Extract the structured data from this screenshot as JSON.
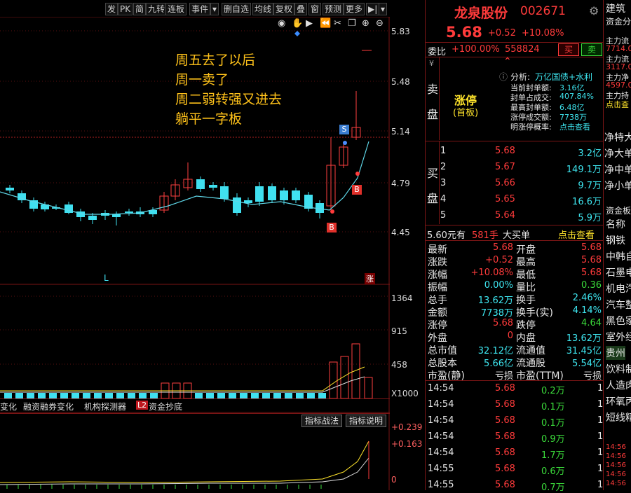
{
  "toolbar": {
    "items": [
      "发",
      "PK",
      "简",
      "九转",
      "连板",
      "事件",
      "▾",
      "删自选",
      "均线",
      "复权",
      "叠",
      "窗",
      "预测",
      "更多",
      "▶|",
      "▾"
    ]
  },
  "chart": {
    "y_labels": [
      "5.83",
      "5.48",
      "5.14",
      "4.79",
      "4.45"
    ],
    "vol_labels": [
      "1364",
      "915",
      "458",
      "X1000"
    ],
    "ind_labels": [
      "+0.239",
      "+0.163",
      "0"
    ],
    "marker_l": "L",
    "marker_zhang": "涨",
    "badge_s": "S",
    "badge_b": "B",
    "annotation": [
      "周五去了以后",
      "周一卖了",
      "周二弱转强又进去",
      "躺平一字板"
    ],
    "tabs": [
      "变化",
      "融资融券变化",
      "机构探测器",
      "L2",
      "资金抄底"
    ],
    "ind_buttons": [
      "指标战法",
      "指标说明"
    ],
    "icons": [
      "eye-icon",
      "hand-icon",
      "play-icon",
      "scissors-icon",
      "copy-icon",
      "zoom-in-icon",
      "zoom-out-icon"
    ]
  },
  "stock": {
    "name": "龙泉股份",
    "code": "002671",
    "price": "5.68",
    "change": "+0.52",
    "change_pct": "+10.08%",
    "weibi_label": "委比",
    "weibi": "+100.00%",
    "weicha": "558824",
    "buy_btn": "买",
    "sell_btn": "卖"
  },
  "sell_side": {
    "label1": "卖",
    "label2": "盘",
    "limit_up": "涨停",
    "limit_sub": "(首板)",
    "analysis_label": "分析:",
    "analysis_value": "万亿国债+水利",
    "rows": [
      {
        "k": "当前封单额:",
        "v": "3.16亿"
      },
      {
        "k": "封单占成交:",
        "v": "407.84%"
      },
      {
        "k": "最高封单额:",
        "v": "6.48亿"
      },
      {
        "k": "涨停成交额:",
        "v": "7738万"
      },
      {
        "k": "明涨停概率:",
        "v": "点击查看"
      }
    ]
  },
  "buy_side": {
    "label1": "买",
    "label2": "盘",
    "rows": [
      {
        "n": "1",
        "p": "5.68",
        "v": "3.2亿"
      },
      {
        "n": "2",
        "p": "5.67",
        "v": "149.1万"
      },
      {
        "n": "3",
        "p": "5.66",
        "v": "9.7万"
      },
      {
        "n": "4",
        "p": "5.65",
        "v": "16.6万"
      },
      {
        "n": "5",
        "p": "5.64",
        "v": "5.9万"
      }
    ]
  },
  "big_order": {
    "price": "5.60元有",
    "qty": "581手",
    "type": "大买单",
    "link": "点击查看"
  },
  "stats": [
    {
      "k1": "最新",
      "v1": "5.68",
      "k2": "开盘",
      "v2": "5.68"
    },
    {
      "k1": "涨跌",
      "v1": "+0.52",
      "k2": "最高",
      "v2": "5.68"
    },
    {
      "k1": "涨幅",
      "v1": "+10.08%",
      "k2": "最低",
      "v2": "5.68"
    },
    {
      "k1": "振幅",
      "v1": "0.00%",
      "k2": "量比",
      "v2": "0.36"
    },
    {
      "k1": "总手",
      "v1": "13.62万",
      "k2": "换手",
      "v2": "2.46%"
    },
    {
      "k1": "金额",
      "v1": "7738万",
      "k2": "换手(实)",
      "v2": "4.14%"
    },
    {
      "k1": "涨停",
      "v1": "5.68",
      "k2": "跌停",
      "v2": "4.64"
    },
    {
      "k1": "外盘",
      "v1": "0",
      "k2": "内盘",
      "v2": "13.62万"
    },
    {
      "k1": "总市值",
      "v1": "32.12亿",
      "k2": "流通值",
      "v2": "31.45亿"
    },
    {
      "k1": "总股本",
      "v1": "5.66亿",
      "k2": "流通股",
      "v2": "5.54亿"
    },
    {
      "k1": "市盈(静)",
      "v1": "亏损",
      "k2": "市盈(TTM)",
      "v2": "亏损"
    }
  ],
  "ticks": [
    {
      "t": "14:54",
      "p": "5.68",
      "v": "0.2万"
    },
    {
      "t": "14:54",
      "p": "5.68",
      "v": "0.1万"
    },
    {
      "t": "14:54",
      "p": "5.68",
      "v": "0.1万"
    },
    {
      "t": "14:54",
      "p": "5.68",
      "v": "0.9万"
    },
    {
      "t": "14:54",
      "p": "5.68",
      "v": "1.7万"
    },
    {
      "t": "14:55",
      "p": "5.68",
      "v": "0.6万"
    },
    {
      "t": "14:55",
      "p": "5.68",
      "v": "0.7万"
    }
  ],
  "far_right": {
    "top": [
      "建筑",
      "资金分"
    ],
    "zl": [
      "主力流",
      "7714.0",
      "主力流",
      "3117.0",
      "主力净",
      "4597.0",
      "主力持",
      "点击查"
    ],
    "net": [
      "净特大",
      "净大单",
      "净中单",
      "净小单"
    ],
    "sector_hdr": "资金板",
    "sector_sub": "名称",
    "sectors": [
      "钢铁",
      "中韩自",
      "石墨电",
      "机电汽",
      "汽车整",
      "黑色家",
      "室外经",
      "贵州",
      "饮料制",
      "人造肉",
      "环氧丙",
      "短线精"
    ],
    "mini": [
      "14:56",
      "14:56",
      "14:56",
      "14:56",
      "14:56"
    ]
  }
}
